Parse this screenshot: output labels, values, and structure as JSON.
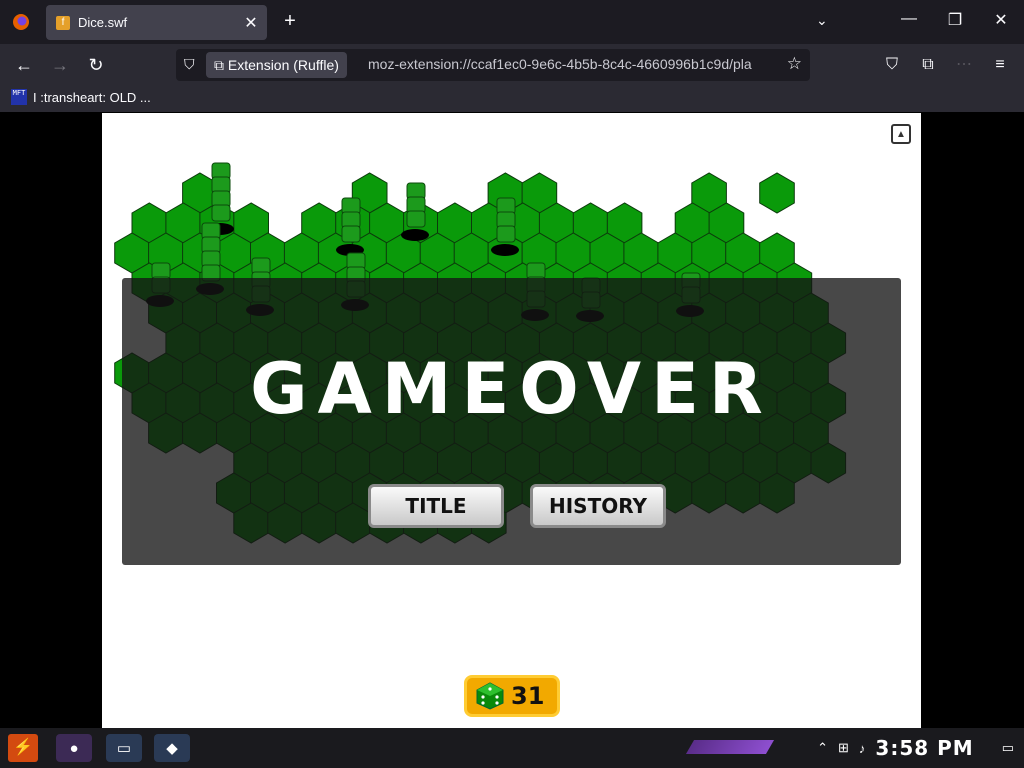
{
  "browser": {
    "tab_title": "Dice.swf",
    "tab_close": "✕",
    "new_tab": "+",
    "url_chip": "Extension (Ruffle)",
    "url": "moz-extension://ccaf1ec0-9e6c-4b5b-8c4c-4660996b1c9d/pla",
    "bookmark": "I :transheart: OLD ...",
    "bookmark_icon_text": "MFT"
  },
  "game": {
    "title": "GAMEOVER",
    "buttons": {
      "title_label": "TITLE",
      "history_label": "HISTORY"
    },
    "dice_count": "31",
    "colors": {
      "hex_green": "#0a9a0a",
      "hex_dark": "#0b4a0b",
      "outline": "#1a2a55",
      "panel": "#141414"
    }
  },
  "taskbar": {
    "clock": "3:58 PM",
    "start_label": "⚡"
  }
}
